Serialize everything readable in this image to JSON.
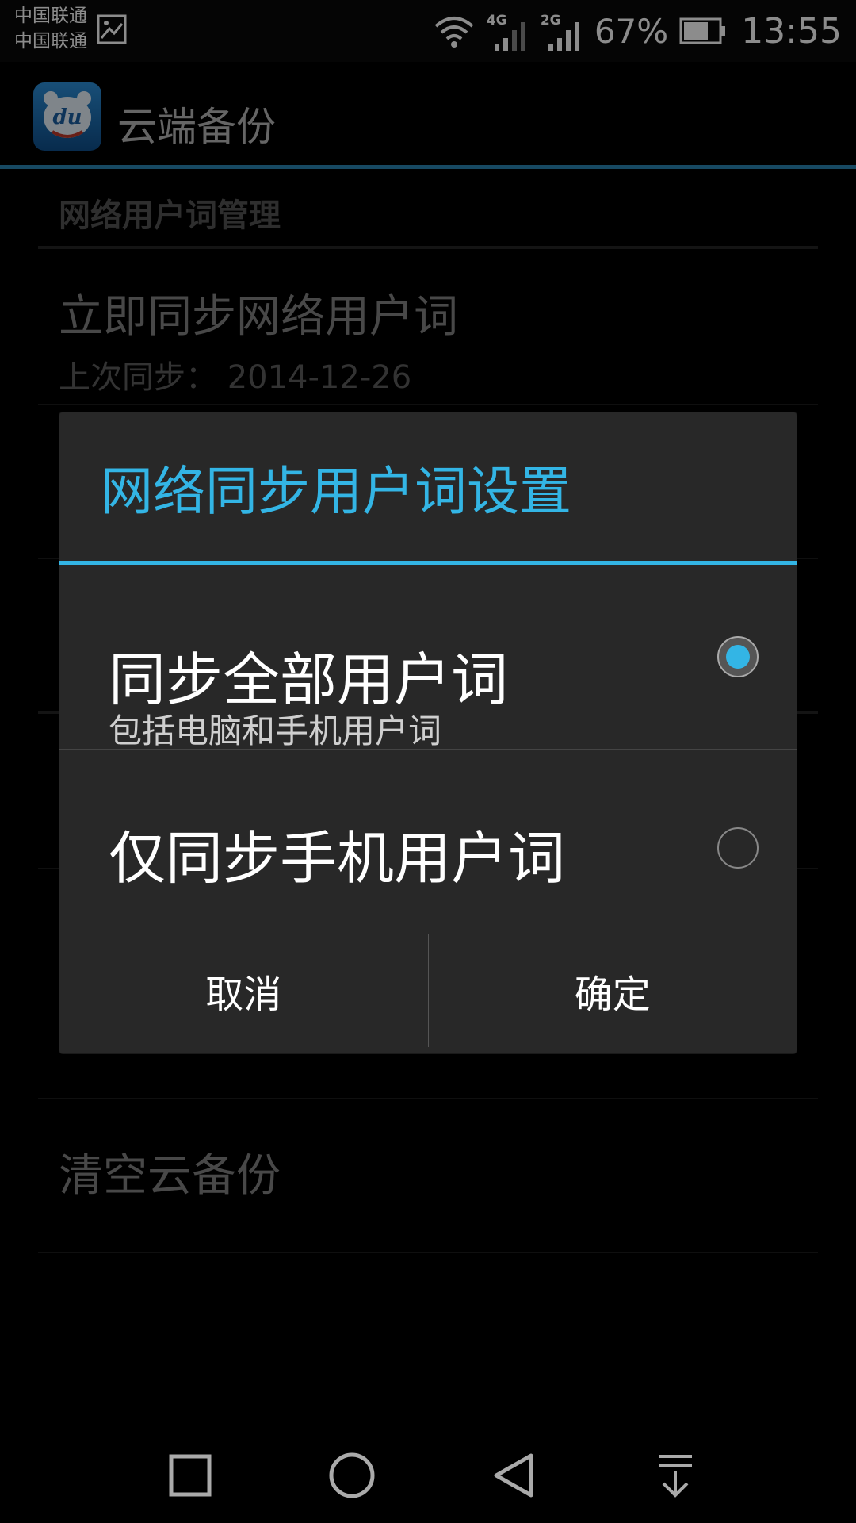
{
  "status_bar": {
    "carrier_1": "中国联通",
    "carrier_2": "中国联通",
    "network_1": "4G",
    "network_2": "2G",
    "battery_percent": "67%",
    "time": "13:55"
  },
  "app_bar": {
    "title": "云端备份",
    "app_icon_text": "du"
  },
  "settings": {
    "section_header": "网络用户词管理",
    "sync_now": {
      "title": "立即同步网络用户词",
      "summary": "上次同步： 2014-12-26"
    },
    "clear_backup": {
      "title": "清空云备份"
    }
  },
  "dialog": {
    "title": "网络同步用户词设置",
    "options": [
      {
        "label": "同步全部用户词",
        "sub": "包括电脑和手机用户词",
        "selected": true
      },
      {
        "label": "仅同步手机用户词",
        "sub": "",
        "selected": false
      }
    ],
    "cancel_label": "取消",
    "ok_label": "确定"
  },
  "colors": {
    "accent": "#33b5e5",
    "dialog_bg": "#282828",
    "appbar_divider": "#2a86b3"
  },
  "icons": {
    "status": [
      "image-notification-icon",
      "wifi-icon",
      "signal-icon",
      "battery-icon"
    ],
    "nav": [
      "recent-apps-icon",
      "home-icon",
      "back-icon",
      "notification-pull-down-icon"
    ]
  }
}
